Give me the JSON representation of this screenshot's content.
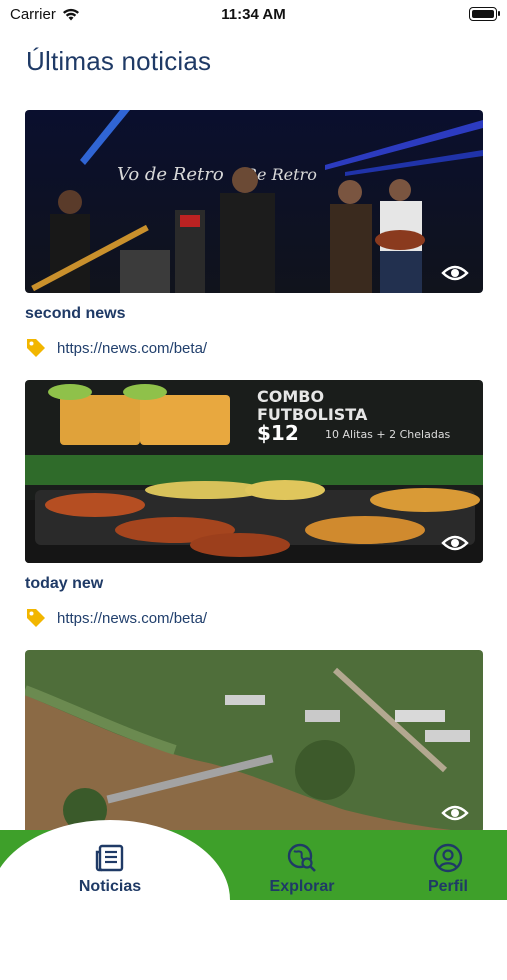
{
  "status_bar": {
    "carrier": "Carrier",
    "time": "11:34 AM"
  },
  "page": {
    "title": "Últimas noticias"
  },
  "news": [
    {
      "title": "second news",
      "link": "https://news.com/beta/",
      "image": "concert-band-stage"
    },
    {
      "title": "today new",
      "link": "https://news.com/beta/",
      "image": "combo-futbolista-food-ad"
    },
    {
      "title": "",
      "link": "",
      "image": "aerial-river-flood"
    }
  ],
  "promo": {
    "line1": "COMBO",
    "line2": "FUTBOLISTA",
    "line3": "10 Alitas + 2 Cheladas",
    "price": "$12"
  },
  "tab_bar": {
    "tabs": [
      {
        "label": "Noticias",
        "icon": "newspaper-icon",
        "active": true
      },
      {
        "label": "Explorar",
        "icon": "globe-search-icon",
        "active": false
      },
      {
        "label": "Perfil",
        "icon": "user-circle-icon",
        "active": false
      }
    ]
  },
  "colors": {
    "primary_text": "#1f3a66",
    "tab_bar": "#3ea02a",
    "tag": "#f2b600"
  }
}
